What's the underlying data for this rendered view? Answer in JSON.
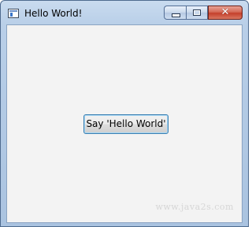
{
  "window": {
    "title": "Hello World!",
    "app_icon": "java-app-icon"
  },
  "caption_buttons": {
    "minimize_icon": "minimize-icon",
    "maximize_icon": "maximize-icon",
    "close_icon": "close-icon",
    "close_glyph": "✕"
  },
  "content": {
    "button_label": "Say 'Hello World'",
    "watermark": "www.java2s.com"
  },
  "colors": {
    "client_bg": "#f3f3f3",
    "button_focus_border": "#3c7fb1",
    "close_red": "#c4402b",
    "titlebar": "#b9cfe8"
  }
}
